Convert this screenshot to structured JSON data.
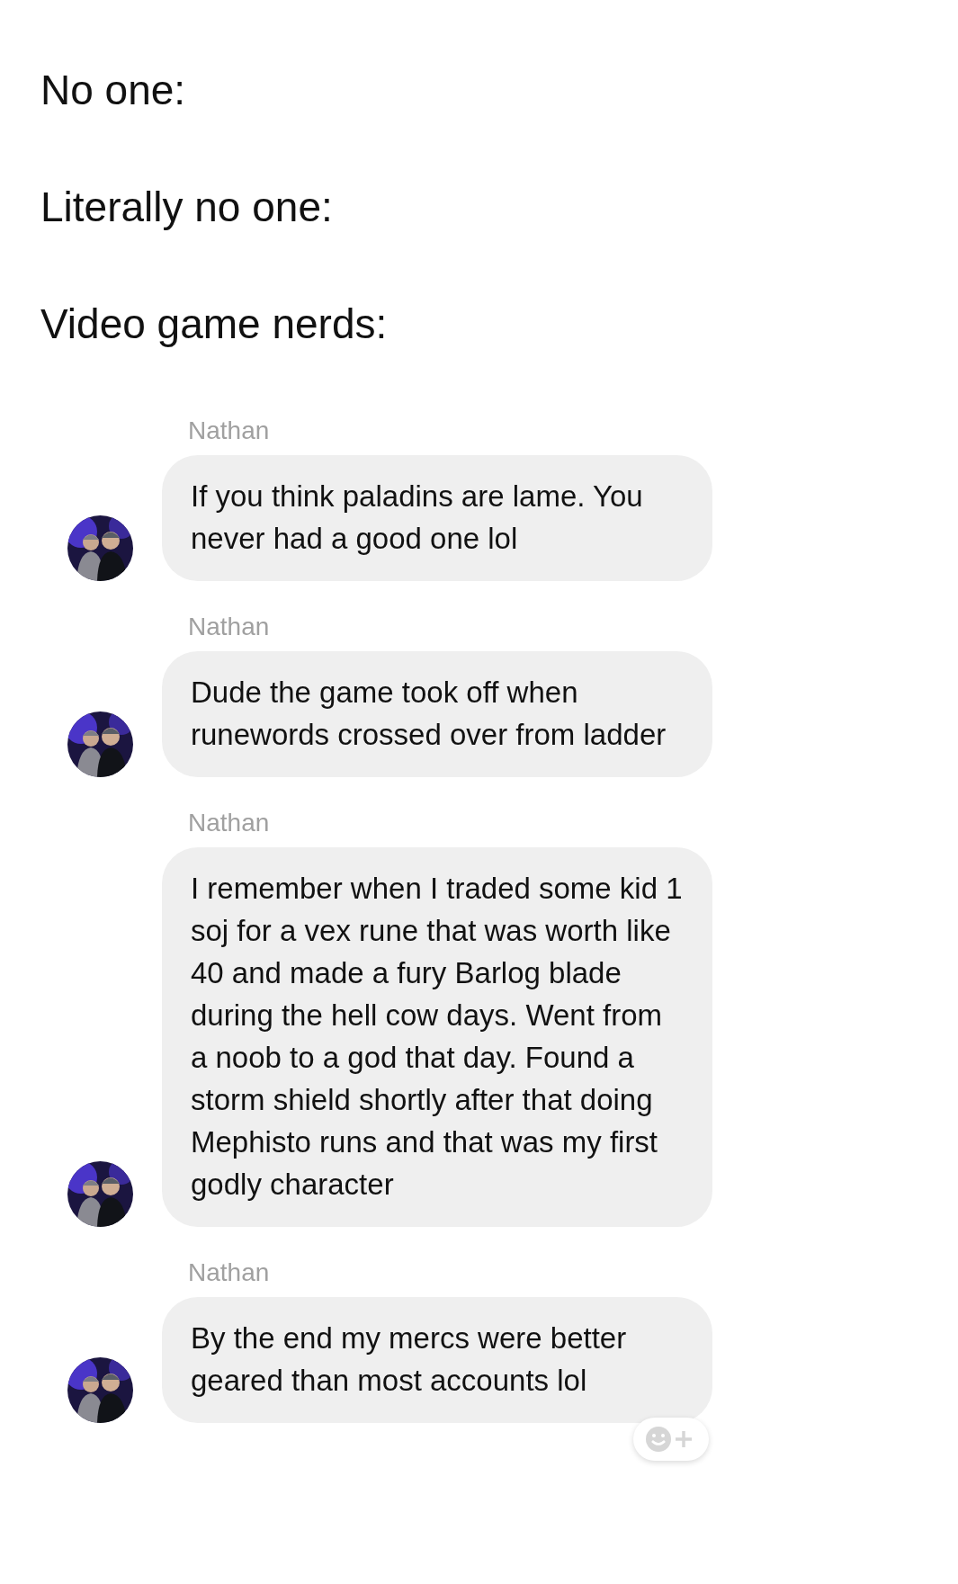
{
  "caption": [
    "No one:",
    "Literally no one:",
    "Video game nerds:"
  ],
  "messages": [
    {
      "sender": "Nathan",
      "text": "If you think paladins are lame. You never had a good one lol"
    },
    {
      "sender": "Nathan",
      "text": "Dude the game took off when runewords crossed over from ladder"
    },
    {
      "sender": "Nathan",
      "text": "I remember when I traded some kid 1 soj for a vex rune that was worth like 40 and made a fury Barlog blade during the hell cow days. Went from a noob to a god that day. Found a storm shield shortly after that doing Mephisto runs and that was my first godly character"
    },
    {
      "sender": "Nathan",
      "text": "By the end my mercs were better geared than most accounts lol"
    }
  ]
}
